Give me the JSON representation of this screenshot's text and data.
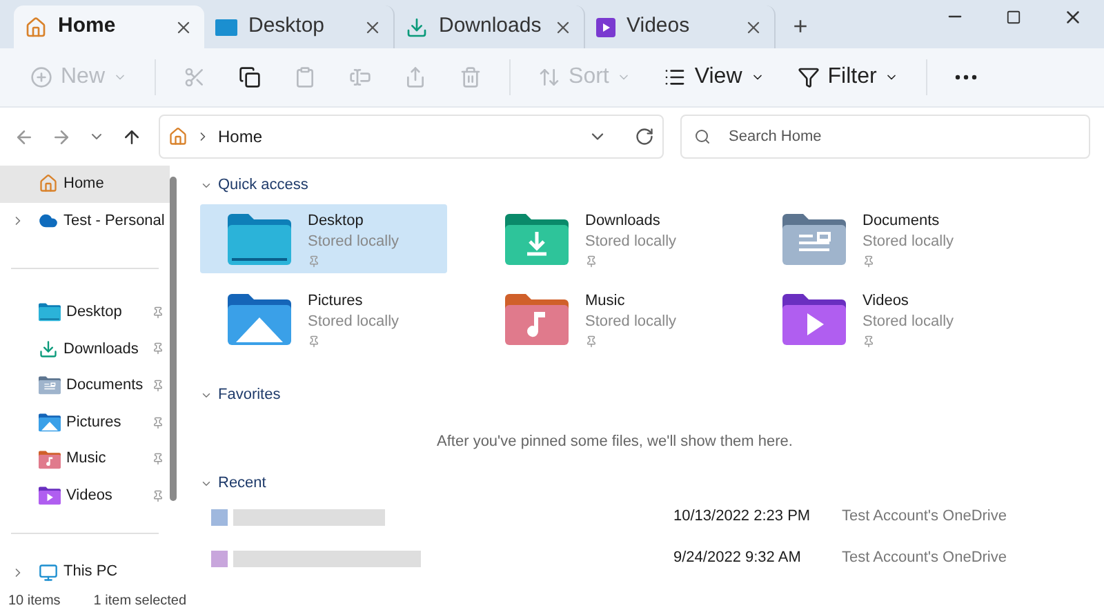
{
  "tabs": [
    {
      "label": "Home",
      "kind": "home",
      "selected": true
    },
    {
      "label": "Desktop",
      "kind": "desktop",
      "selected": false
    },
    {
      "label": "Downloads",
      "kind": "download",
      "selected": false
    },
    {
      "label": "Videos",
      "kind": "video",
      "selected": false
    }
  ],
  "new_tab": "+",
  "toolbar": [
    {
      "kind": "new",
      "label": "New",
      "disabled": true
    },
    {
      "kind": "cut",
      "disabled": true
    },
    {
      "kind": "copy",
      "disabled": false
    },
    {
      "kind": "paste",
      "disabled": true
    },
    {
      "kind": "rename",
      "disabled": true
    },
    {
      "kind": "share",
      "disabled": true
    },
    {
      "kind": "delete",
      "disabled": true
    },
    {
      "kind": "sort",
      "label": "Sort",
      "disabled": true
    },
    {
      "kind": "view",
      "label": "View",
      "disabled": false
    },
    {
      "kind": "filter",
      "label": "Filter",
      "disabled": false
    },
    {
      "kind": "more",
      "disabled": false
    }
  ],
  "address": {
    "location": "Home",
    "search_placeholder": "Search Home"
  },
  "sidebar": {
    "sections": [
      {
        "items": [
          {
            "label": "Home",
            "kind": "home",
            "selected": true,
            "pinned": false,
            "expandable": false
          },
          {
            "label": "Test - Personal",
            "kind": "cloud",
            "selected": false,
            "pinned": false,
            "expandable": true
          }
        ]
      },
      {
        "items": [
          {
            "label": "Desktop",
            "kind": "desktop",
            "selected": false,
            "pinned": true,
            "expandable": false
          },
          {
            "label": "Downloads",
            "kind": "download",
            "selected": false,
            "pinned": true,
            "expandable": false
          },
          {
            "label": "Documents",
            "kind": "documents",
            "selected": false,
            "pinned": true,
            "expandable": false
          },
          {
            "label": "Pictures",
            "kind": "pictures",
            "selected": false,
            "pinned": true,
            "expandable": false
          },
          {
            "label": "Music",
            "kind": "music",
            "selected": false,
            "pinned": true,
            "expandable": false
          },
          {
            "label": "Videos",
            "kind": "video",
            "selected": false,
            "pinned": true,
            "expandable": false
          }
        ]
      },
      {
        "items": [
          {
            "label": "This PC",
            "kind": "pc",
            "selected": false,
            "pinned": false,
            "expandable": true
          }
        ]
      }
    ]
  },
  "quick_access": {
    "title": "Quick access",
    "expanded": true,
    "items": [
      {
        "name": "Desktop",
        "status": "Stored locally",
        "kind": "desktop",
        "selected": true
      },
      {
        "name": "Downloads",
        "status": "Stored locally",
        "kind": "download",
        "selected": false
      },
      {
        "name": "Documents",
        "status": "Stored locally",
        "kind": "documents",
        "selected": false
      },
      {
        "name": "Pictures",
        "status": "Stored locally",
        "kind": "pictures",
        "selected": false
      },
      {
        "name": "Music",
        "status": "Stored locally",
        "kind": "music",
        "selected": false
      },
      {
        "name": "Videos",
        "status": "Stored locally",
        "kind": "video",
        "selected": false
      }
    ]
  },
  "favorites": {
    "title": "Favorites",
    "message": "After you've pinned some files, we'll show them here."
  },
  "recent": {
    "title": "Recent",
    "rows": [
      {
        "color": "#9fb8de",
        "date": "10/13/2022 2:23 PM",
        "location": "Test Account's OneDrive"
      },
      {
        "color": "#c8a6dc",
        "date": "9/24/2022 9:32 AM",
        "location": "Test Account's OneDrive"
      }
    ]
  },
  "status_bar": {
    "count": "10 items",
    "selection": "1 item selected"
  }
}
